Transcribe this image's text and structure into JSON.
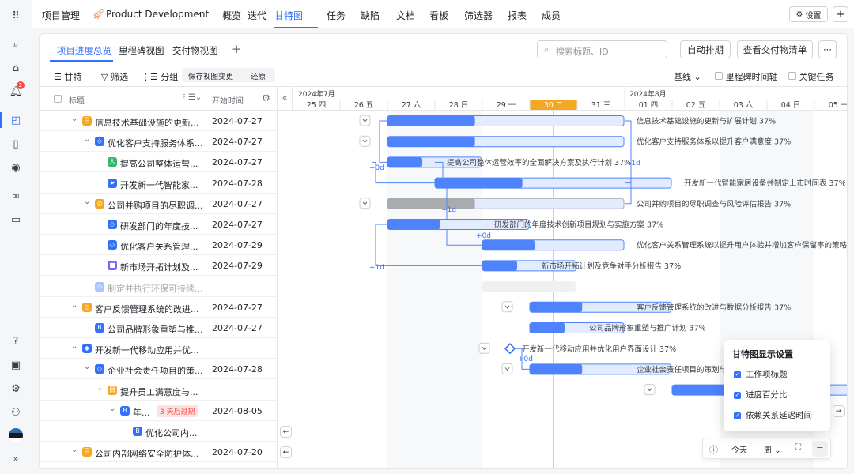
{
  "app": {
    "project_label": "项目管理",
    "project_name": "Product Development",
    "nav": [
      "概览",
      "迭代",
      "甘特图",
      "任务",
      "缺陷",
      "文档",
      "看板",
      "筛选器",
      "报表",
      "成员"
    ],
    "active_nav": "甘特图",
    "settings_label": "设置",
    "notification_count": "2"
  },
  "tabs": {
    "items": [
      "项目进度总览",
      "里程碑视图",
      "交付物视图"
    ],
    "active": "项目进度总览",
    "add": "+"
  },
  "search": {
    "placeholder": "搜索标题、ID"
  },
  "actions": {
    "auto_schedule": "自动排期",
    "view_deliverables": "查看交付物清单",
    "more": "···"
  },
  "toolbar": {
    "gantt": "甘特",
    "filter": "筛选",
    "group": "分组",
    "save_view": "保存视图变更",
    "restore": "还原",
    "baseline": "基线",
    "milestone_axis": "里程碑时间轴",
    "key_task": "关键任务"
  },
  "table_header": {
    "title": "标题",
    "start": "开始时间"
  },
  "timeline": {
    "month1": "2024年7月",
    "month2": "2024年8月",
    "days": [
      "25 四",
      "26 五",
      "27 六",
      "28 日",
      "29 一",
      "30 二",
      "31 三",
      "01 四",
      "02 五",
      "03 六",
      "04 日",
      "05 一"
    ],
    "today_index": 5
  },
  "rows": [
    {
      "indent": 1,
      "caret": "⌄",
      "icon": "目",
      "icon_color": "#f5a623",
      "name": "信息技术基础设施的更新...",
      "start": "2024-07-27"
    },
    {
      "indent": 2,
      "caret": "⌄",
      "icon": "◇",
      "icon_color": "#3370ff",
      "name": "优化客户支持服务体系...",
      "start": "2024-07-27"
    },
    {
      "indent": 3,
      "caret": "",
      "icon": "人",
      "icon_color": "#34b76a",
      "name": "提高公司整体运营...",
      "start": "2024-07-27"
    },
    {
      "indent": 3,
      "caret": "",
      "icon": "➤",
      "icon_color": "#3370ff",
      "name": "开发新一代智能家...",
      "start": "2024-07-28"
    },
    {
      "indent": 2,
      "caret": "⌄",
      "icon": "◎",
      "icon_color": "#f5a623",
      "name": "公司并购项目的尽职调...",
      "start": "2024-07-27"
    },
    {
      "indent": 3,
      "caret": "",
      "icon": "◇",
      "icon_color": "#3370ff",
      "name": "研发部门的年度技...",
      "start": "2024-07-27"
    },
    {
      "indent": 3,
      "caret": "",
      "icon": "◇",
      "icon_color": "#3370ff",
      "name": "优化客户关系管理...",
      "start": "2024-07-29"
    },
    {
      "indent": 3,
      "caret": "",
      "icon": "■",
      "icon_color": "#7b61ff",
      "name": "新市场开拓计划及...",
      "start": "2024-07-29"
    },
    {
      "indent": 2,
      "caret": "",
      "icon": "◇",
      "icon_color": "#a9c4ff",
      "name": "制定并执行环保可持续...",
      "start": "",
      "muted": true
    },
    {
      "indent": 1,
      "caret": "⌄",
      "icon": "◎",
      "icon_color": "#f5a623",
      "name": "客户反馈管理系统的改进...",
      "start": "2024-07-27"
    },
    {
      "indent": 2,
      "caret": "",
      "icon": "B",
      "icon_color": "#3370ff",
      "name": "公司品牌形象重塑与推...",
      "start": "2024-07-27"
    },
    {
      "indent": 1,
      "caret": "⌄",
      "icon": "◆",
      "icon_color": "#3370ff",
      "name": "开发新一代移动应用并优...",
      "start": ""
    },
    {
      "indent": 2,
      "caret": "⌄",
      "icon": "◇",
      "icon_color": "#3370ff",
      "name": "企业社会责任项目的策...",
      "start": "2024-07-28"
    },
    {
      "indent": 3,
      "caret": "⌄",
      "icon": "目",
      "icon_color": "#f5a623",
      "name": "提升员工满意度与...",
      "start": ""
    },
    {
      "indent": 4,
      "caret": "⌄",
      "icon": "B",
      "icon_color": "#3370ff",
      "name": "年...",
      "start": "2024-08-05",
      "badge": "3 天后过期"
    },
    {
      "indent": 5,
      "caret": "",
      "icon": "B",
      "icon_color": "#3370ff",
      "name": "优化公司内...",
      "start": ""
    },
    {
      "indent": 1,
      "caret": "⌄",
      "icon": "目",
      "icon_color": "#f5a623",
      "name": "公司内部网络安全防护体...",
      "start": "2024-07-20"
    }
  ],
  "bar_labels": [
    "信息技术基础设施的更新与扩展计划 37%",
    "优化客户支持服务体系以提升客户满意度 37%",
    "提高公司整体运营效率的全面解决方案及执行计划 37%",
    "开发新一代智能家居设备并制定上市时间表 37%",
    "公司并购项目的尽职调查与风险评估报告 37%",
    "研发部门的年度技术创新项目规划与实施方案 37%",
    "优化客户关系管理系统以提升用户体验并增加客户保留率的策略分析",
    "新市场开拓计划及竞争对手分析报告 37%",
    "客户反馈管理系统的改进与数据分析报告 37%",
    "公司品牌形象重塑与推广计划 37%",
    "开发新一代移动应用并优化用户界面设计 37%",
    "企业社会责任项目的策划与执"
  ],
  "dep_labels": [
    "+0d",
    "-1d",
    "+1d",
    "+0d",
    "+1d",
    "+0d"
  ],
  "popup": {
    "title": "甘特图显示设置",
    "options": [
      "工作项标题",
      "进度百分比",
      "依赖关系延迟时间"
    ]
  },
  "bottom_bar": {
    "today": "今天",
    "week": "周"
  },
  "chart_data": {
    "type": "gantt",
    "x_axis_start": "2024-07-25",
    "x_axis_end": "2024-08-05",
    "today": "2024-07-30",
    "progress_percent": 37,
    "tasks": [
      {
        "name": "信息技术基础设施的更新与扩展计划",
        "start": "2024-07-27",
        "end": "2024-07-31",
        "progress": 37
      },
      {
        "name": "优化客户支持服务体系以提升客户满意度",
        "start": "2024-07-27",
        "end": "2024-07-31",
        "progress": 37
      },
      {
        "name": "提高公司整体运营效率的全面解决方案及执行计划",
        "start": "2024-07-27",
        "end": "2024-07-28",
        "progress": 37
      },
      {
        "name": "开发新一代智能家居设备并制定上市时间表",
        "start": "2024-07-28",
        "end": "2024-08-01",
        "progress": 37
      },
      {
        "name": "公司并购项目的尽职调查与风险评估报告",
        "start": "2024-07-27",
        "end": "2024-07-31",
        "progress": 37
      },
      {
        "name": "研发部门的年度技术创新项目规划与实施方案",
        "start": "2024-07-27",
        "end": "2024-07-29",
        "progress": 37
      },
      {
        "name": "优化客户关系管理系统以提升用户体验并增加客户保留率的策略分析",
        "start": "2024-07-29",
        "end": "2024-07-31",
        "progress": 37
      },
      {
        "name": "新市场开拓计划及竞争对手分析报告",
        "start": "2024-07-29",
        "end": "2024-07-30",
        "progress": 37
      },
      {
        "name": "客户反馈管理系统的改进与数据分析报告",
        "start": "2024-07-30",
        "end": "2024-08-01",
        "progress": 37
      },
      {
        "name": "公司品牌形象重塑与推广计划",
        "start": "2024-07-30",
        "end": "2024-07-31",
        "progress": 37
      },
      {
        "name": "开发新一代移动应用并优化用户界面设计",
        "start": "2024-07-29",
        "end": "2024-07-29",
        "progress": 37,
        "milestone": true
      },
      {
        "name": "企业社会责任项目的策划与执行",
        "start": "2024-07-30",
        "end": "2024-08-01",
        "progress": 37
      }
    ]
  }
}
